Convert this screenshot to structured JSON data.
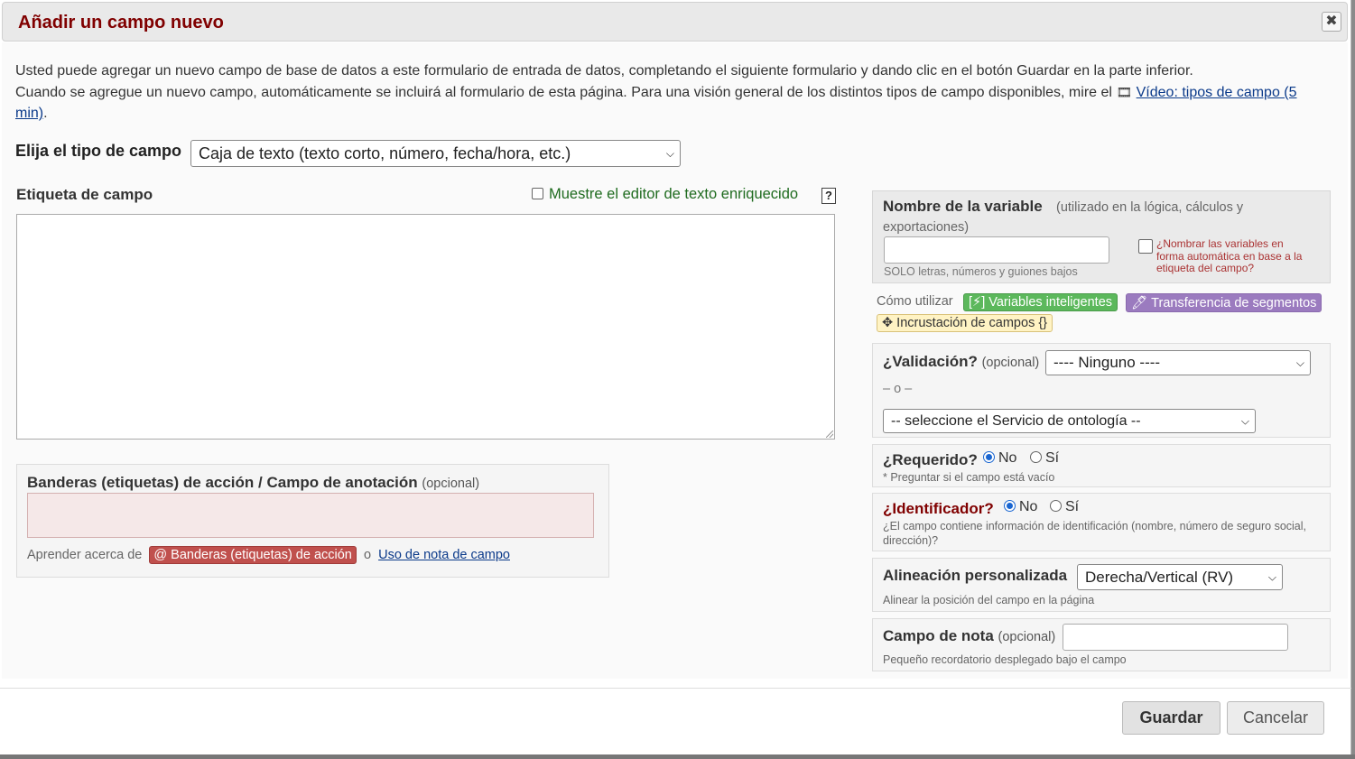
{
  "dialog": {
    "title": "Añadir un campo nuevo",
    "close_glyph": "✖"
  },
  "intro": {
    "line1": "Usted puede agregar un nuevo campo de base de datos a este formulario de entrada de datos, completando el siguiente formulario y dando clic en el botón Guardar en la parte inferior.",
    "line2_prefix": "Cuando se agregue un nuevo campo, automáticamente se incluirá al formulario de esta página. Para una visión general de los distintos tipos de campo disponibles, mire el ",
    "video_link": "Vídeo: tipos de campo (5 min)",
    "line2_suffix": "."
  },
  "field_type": {
    "label": "Elija el tipo de campo",
    "selected": "Caja de texto (texto corto, número, fecha/hora, etc.)"
  },
  "field_label": {
    "title": "Etiqueta de campo",
    "rich_text_toggle": "Muestre el editor de texto enriquecido",
    "help": "?"
  },
  "action_tags": {
    "title": "Banderas (etiquetas) de acción",
    "separator": " / ",
    "title2": "Campo de anotación",
    "optional": "(opcional)",
    "learn_prefix": "Aprender acerca de",
    "badge": "@ Banderas (etiquetas) de acción",
    "or": "o",
    "link": "Uso de nota de campo"
  },
  "variable": {
    "title": "Nombre de la variable",
    "subtitle": "(utilizado en la lógica, cálculos y exportaciones)",
    "hint": "SOLO letras, números y guiones bajos",
    "auto_name": "¿Nombrar las variables en forma automática en base a la etiqueta del campo?"
  },
  "howto": {
    "label": "Cómo utilizar",
    "smart_variables": "[⚡] Variables inteligentes",
    "piping": "🖊 Transferencia de segmentos",
    "embedding": "✥ Incrustación de campos {}"
  },
  "validation": {
    "title": "¿Validación?",
    "optional": "(opcional)",
    "selected": "---- Ninguno ----",
    "or": "– o –",
    "ontology_selected": "-- seleccione el Servicio de ontología --"
  },
  "required": {
    "title": "¿Requerido?",
    "no": "No",
    "yes": "Sí",
    "hint": "* Preguntar si el campo está vacío"
  },
  "identifier": {
    "title": "¿Identificador?",
    "no": "No",
    "yes": "Sí",
    "hint": "¿El campo contiene información de identificación (nombre, número de seguro social, dirección)?"
  },
  "alignment": {
    "title": "Alineación personalizada",
    "selected": "Derecha/Vertical (RV)",
    "hint": "Alinear la posición del campo en la página"
  },
  "field_note": {
    "title": "Campo de nota",
    "optional": "(opcional)",
    "hint": "Pequeño recordatorio desplegado bajo el campo"
  },
  "footer": {
    "save": "Guardar",
    "cancel": "Cancelar"
  }
}
